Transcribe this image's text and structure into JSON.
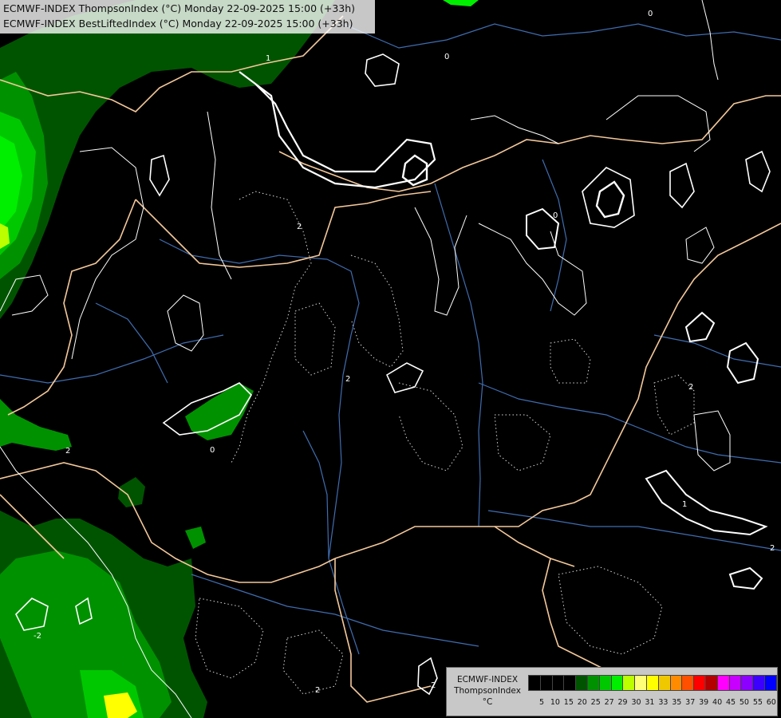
{
  "header": {
    "line1": "ECMWF-INDEX ThompsonIndex (°C) Monday 22-09-2025 15:00 (+33h)",
    "line2": "ECMWF-INDEX BestLiftedIndex (°C) Monday 22-09-2025 15:00 (+33h)"
  },
  "map": {
    "background_color": "#000000",
    "border_color": "#f4c89a",
    "river_color": "#3f6db0",
    "contour_color": "#ffffff",
    "field_colors": [
      "#005400",
      "#009100",
      "#00c800",
      "#00ee00",
      "#bbff00",
      "#ffff00"
    ],
    "contour_labels": [
      "0",
      "0",
      "1",
      "2",
      "2",
      "0",
      "2",
      "0",
      "1",
      "2",
      "2",
      "-2",
      "2",
      "2"
    ]
  },
  "legend": {
    "title_lines": [
      "ECMWF-INDEX",
      "ThompsonIndex",
      "°C"
    ],
    "ticks": [
      "5",
      "10",
      "15",
      "20",
      "25",
      "27",
      "29",
      "30",
      "31",
      "33",
      "35",
      "37",
      "39",
      "40",
      "45",
      "50",
      "55",
      "60"
    ],
    "colors": [
      "#000000",
      "#000000",
      "#000000",
      "#000000",
      "#005400",
      "#009100",
      "#00c800",
      "#00ee00",
      "#bbff00",
      "#ffff78",
      "#ffff00",
      "#f0c800",
      "#ff8c00",
      "#ff5000",
      "#ff0000",
      "#b40000",
      "#ff00ff",
      "#c800ff",
      "#8c00ff",
      "#3c00ff",
      "#0000ff"
    ]
  }
}
